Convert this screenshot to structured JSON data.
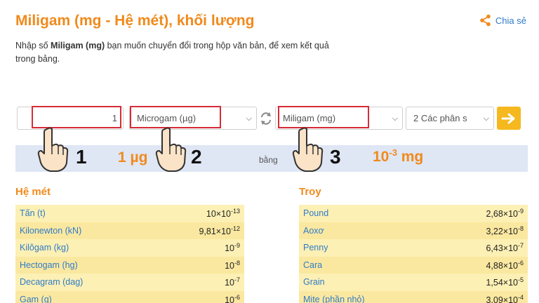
{
  "header": {
    "title": "Miligam (mg - Hệ mét), khối lượng",
    "share_label": "Chia sẻ"
  },
  "description": {
    "pre": "Nhập số ",
    "bold": "Miligam (mg)",
    "post": " bạn muốn chuyển đổi trong hộp văn bản, để xem kết quả trong bảng."
  },
  "converter": {
    "input_value": "1",
    "from_unit": "Microgam (µg)",
    "to_unit": "Miligam (mg)",
    "precision": "2 Các phân s",
    "go_icon": "arrow-right-icon",
    "swap_icon": "swap-icon"
  },
  "result": {
    "from_text": "1 µg",
    "middle_text": "bằng",
    "to_base": "10",
    "to_exp": "-3",
    "to_unit": " mg"
  },
  "annotations": {
    "steps": [
      "1",
      "2",
      "3"
    ],
    "pointer_icon": "hand-pointer-icon",
    "highlight_color": "#d62b38"
  },
  "left_table": {
    "title": "Hệ mét",
    "rows": [
      {
        "name": "Tấn (t)",
        "base": "10×10",
        "exp": "-13"
      },
      {
        "name": "Kilonewton (kN)",
        "base": "9,81×10",
        "exp": "-12"
      },
      {
        "name": "Kilôgam (kg)",
        "base": "10",
        "exp": "-9"
      },
      {
        "name": "Hectogam (hg)",
        "base": "10",
        "exp": "-8"
      },
      {
        "name": "Decagram (dag)",
        "base": "10",
        "exp": "-7"
      },
      {
        "name": "Gam (g)",
        "base": "10",
        "exp": "-6"
      }
    ]
  },
  "right_table": {
    "title": "Troy",
    "rows": [
      {
        "name": "Pound",
        "base": "2,68×10",
        "exp": "-9"
      },
      {
        "name": "Aoxơ",
        "base": "3,22×10",
        "exp": "-8"
      },
      {
        "name": "Penny",
        "base": "6,43×10",
        "exp": "-7"
      },
      {
        "name": "Cara",
        "base": "4,88×10",
        "exp": "-6"
      },
      {
        "name": "Grain",
        "base": "1,54×10",
        "exp": "-5"
      },
      {
        "name": "Mite (phần nhỏ)",
        "base": "3,09×10",
        "exp": "-4"
      }
    ]
  },
  "colors": {
    "accent": "#f08a1c",
    "link": "#2f7bc8",
    "go_button": "#f5b81e",
    "result_bar": "#dfe6f4"
  }
}
